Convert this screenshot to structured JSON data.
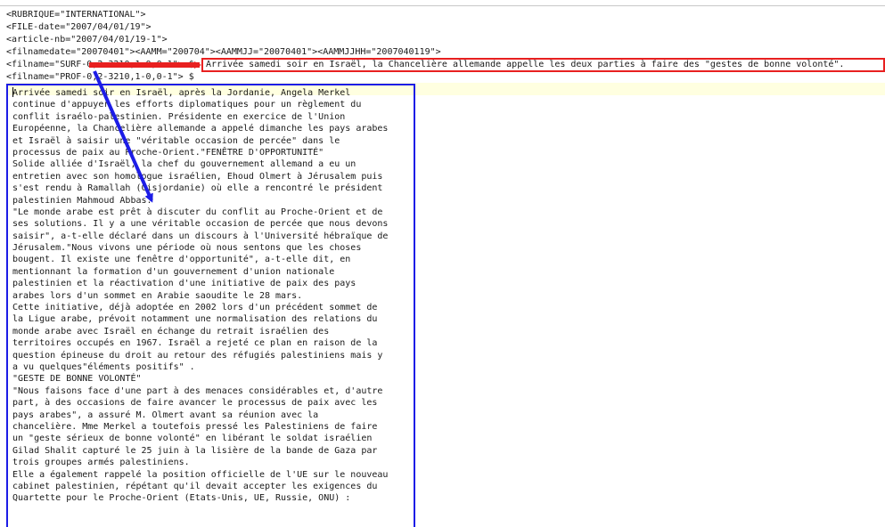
{
  "meta_lines": [
    "<RUBRIQUE=\"INTERNATIONAL\">",
    "<FILE-date=\"2007/04/01/19\">",
    "<article-nb=\"2007/04/01/19-1\">",
    "<filnamedate=\"20070401\"><AAMM=\"200704\"><AAMMJJ=\"20070401\"><AAMMJJHH=\"2007040119\">",
    "<filname=\"SURF-0,2-3210,1-0,0-1\"> $",
    "<filname=\"PROF-0,2-3210,1-0,0-1\"> $"
  ],
  "title_text": "Arrivée samedi soir en Israël, la Chancelière allemande appelle les deux parties à faire des \"gestes de bonne volonté\".",
  "body_lines": [
    "Arrivée samedi soir en Israël, après la Jordanie, Angela Merkel",
    "continue d'appuyer les efforts diplomatiques pour un règlement du",
    "conflit israélo-palestinien. Présidente en exercice de l'Union",
    "Européenne, la Chancelière allemande a appelé dimanche les pays arabes",
    "et Israël à saisir une \"véritable occasion de percée\" dans le",
    "processus de paix au Proche-Orient.\"FENÊTRE D'OPPORTUNITÉ\"",
    "Solide alliée d'Israël, la chef du gouvernement allemand a eu un",
    "entretien avec son homologue israélien, Ehoud Olmert à Jérusalem puis",
    "s'est rendu à Ramallah (Cisjordanie) où elle a rencontré le président",
    "palestinien Mahmoud Abbas.",
    "\"Le monde arabe est prêt à discuter du conflit au Proche-Orient et de",
    "ses solutions. Il y a une véritable occasion de percée que nous devons",
    "saisir\", a-t-elle déclaré dans un discours à l'Université hébraïque de",
    "Jérusalem.\"Nous vivons une période où nous sentons que les choses",
    "bougent. Il existe une fenêtre d'opportunité\", a-t-elle dit, en",
    "mentionnant la formation d'un gouvernement d'union nationale",
    "palestinien et la réactivation d'une initiative de paix des pays",
    "arabes lors d'un sommet en Arabie saoudite le 28 mars.",
    "Cette initiative, déjà adoptée en 2002 lors d'un précédent sommet de",
    "la Ligue arabe, prévoit notamment une normalisation des relations du",
    "monde arabe avec Israël en échange du retrait israélien des",
    "territoires occupés en 1967. Israël a rejeté ce plan en raison de la",
    "question épineuse du droit au retour des réfugiés palestiniens mais y",
    "a vu quelques\"éléments positifs\" .",
    "\"GESTE DE BONNE VOLONTÉ\"",
    "\"Nous faisons face d'une part à des menaces considérables et, d'autre",
    "part, à des occasions de faire avancer le processus de paix avec les",
    "pays arabes\", a assuré M. Olmert avant sa réunion avec la",
    "chancelière. Mme Merkel a toutefois pressé les Palestiniens de faire",
    "un \"geste sérieux de bonne volonté\" en libérant le soldat israélien",
    "Gilad Shalit capturé le 25 juin à la lisière de la bande de Gaza par",
    "trois groupes armés palestiniens.",
    "Elle a également rappelé la position officielle de l'UE sur le nouveau",
    "cabinet palestinien, répétant qu'il devait accepter les exigences du",
    "Quartette pour le Proche-Orient (Etats-Unis, UE, Russie, ONU) :"
  ],
  "colors": {
    "red_annotation": "#e82020",
    "blue_annotation": "#1c1ce6",
    "current_line": "#ffffe0"
  }
}
